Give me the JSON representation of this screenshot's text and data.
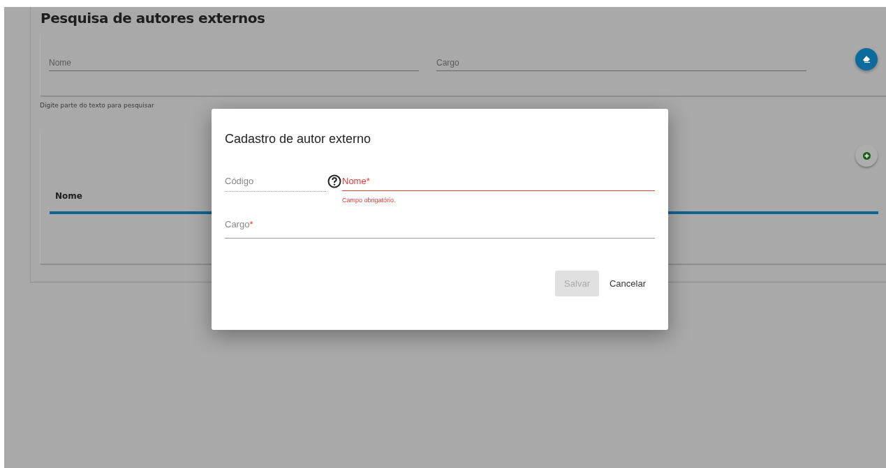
{
  "page": {
    "title": "Pesquisa de autores externos"
  },
  "search": {
    "fields": [
      {
        "placeholder": "Nome"
      },
      {
        "placeholder": "Cargo"
      }
    ],
    "hint": "Digite parte do texto para pesquisar"
  },
  "table": {
    "columns": [
      "Nome"
    ]
  },
  "dialog": {
    "title": "Cadastro de autor externo",
    "fields": [
      {
        "kind": "readonly",
        "label": "Código"
      },
      {
        "kind": "text",
        "label": "Nome",
        "required_mark": "*",
        "error": "Campo obrigatório.",
        "invalid": true
      },
      {
        "kind": "text",
        "label": "Cargo",
        "required_mark": "*",
        "invalid": false
      }
    ],
    "buttons": [
      {
        "label": "Salvar",
        "disabled": true
      },
      {
        "label": "Cancelar",
        "disabled": false
      }
    ]
  }
}
